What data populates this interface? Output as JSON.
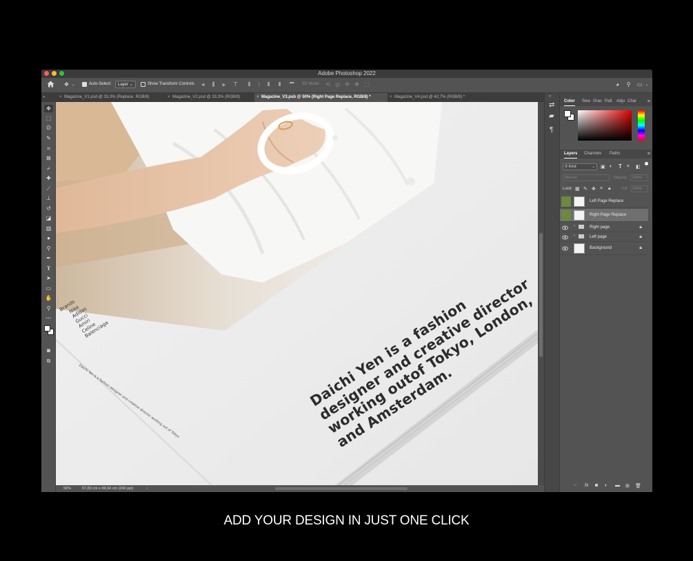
{
  "app": {
    "title": "Adobe Photoshop 2022"
  },
  "options_bar": {
    "auto_select_label": "Auto-Select:",
    "auto_select_value": "Layer",
    "show_transform_label": "Show Transform Controls",
    "mode_3d_label": "3D Mode:"
  },
  "tabs": [
    {
      "label": "Magazine_V1.psd @ 33,3% (Replace, RGB/8)"
    },
    {
      "label": "Magazine_V2.psd @ 33,3% (RGB/8)"
    },
    {
      "label": "Magazine_V3.psb @ 50% (Right Page Replace, RGB/8) *"
    },
    {
      "label": "Magazine_V4.psd @ 42,7% (RGB/8) *"
    }
  ],
  "canvas": {
    "headline": "Daichi Yen is a fashion designer and creative director working outof Tokyo, London, and Amsterdam.",
    "brands_heading": "Brands",
    "brands": [
      "Nike",
      "Adidas",
      "Gucci",
      "Amiri",
      "Celine",
      "Balenciaga"
    ],
    "fine_print": "Daichi Yen is a fashion designer and creative director working out of Tokyo"
  },
  "status": {
    "zoom": "50%",
    "doc_size": "57,83 cm x 49,04 cm (240 ppi)"
  },
  "panels": {
    "color_tabs": [
      "Color",
      "Swa",
      "Grac",
      "Patt",
      "Adju",
      "Char"
    ],
    "layers_tabs": [
      "Layers",
      "Channels",
      "Paths"
    ],
    "filter_kind": "Kind",
    "blend_mode": "Normal",
    "opacity_label": "Opacity:",
    "opacity_value": "100%",
    "lock_label": "Lock:",
    "fill_label": "Fill:",
    "fill_value": "100%",
    "layers": [
      {
        "name": "Left Page Replace"
      },
      {
        "name": "Right Page Replace"
      },
      {
        "name": "Right page"
      },
      {
        "name": "Left page"
      },
      {
        "name": "Background"
      }
    ]
  },
  "tagline": "ADD YOUR DESIGN IN JUST ONE CLICK",
  "colors": {
    "ps_bg": "#535353",
    "accent_green": "#6b8a3f"
  }
}
